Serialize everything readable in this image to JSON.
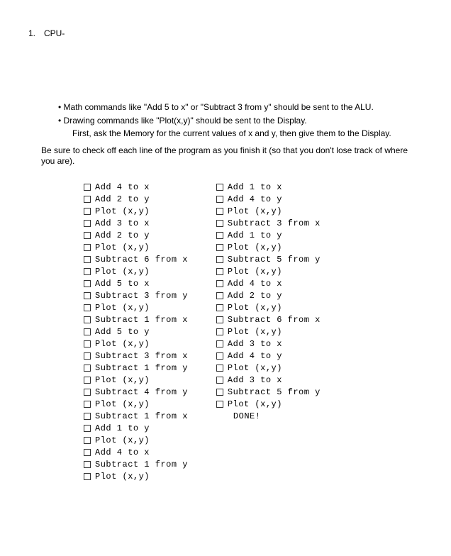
{
  "heading": {
    "number": "1.",
    "text": "CPU-"
  },
  "bullets": [
    {
      "text": "Math commands like \"Add 5 to x\" or \"Subtract 3 from y\" should be sent to the ALU."
    },
    {
      "text": "Drawing commands like \"Plot(x,y)\" should be sent to the Display.",
      "sub": "First, ask the Memory for the current values of x and y, then give them to the Display."
    }
  ],
  "paragraph": "Be sure to check off each line of the program as you finish it (so that you don't lose track of where you are).",
  "program": {
    "col1": [
      "Add 4 to x",
      "Add 2 to y",
      "Plot (x,y)",
      "Add 3 to x",
      "Add 2 to y",
      "Plot (x,y)",
      "Subtract 6 from x",
      "Plot (x,y)",
      "Add 5 to x",
      "Subtract 3 from y",
      "Plot (x,y)",
      "Subtract 1 from x",
      "Add 5 to y",
      "Plot (x,y)",
      "Subtract 3 from x",
      "Subtract 1 from y",
      "Plot (x,y)",
      "Subtract 4 from y",
      "Plot (x,y)",
      "Subtract 1 from x",
      "Add 1 to y",
      "Plot (x,y)",
      "Add 4 to x",
      "Subtract 1 from y",
      "Plot (x,y)"
    ],
    "col2": [
      "Add 1 to x",
      "Add 4 to y",
      "Plot (x,y)",
      "Subtract 3 from x",
      "Add 1 to y",
      "Plot (x,y)",
      "Subtract 5 from y",
      "Plot (x,y)",
      "Add 4 to x",
      "Add 2 to y",
      "Plot (x,y)",
      "Subtract 6 from x",
      "Plot (x,y)",
      "Add 3 to x",
      "Add 4 to y",
      "Plot (x,y)",
      "Add 3 to x",
      "Subtract 5 from y",
      "Plot (x,y)"
    ],
    "done": "DONE!"
  }
}
